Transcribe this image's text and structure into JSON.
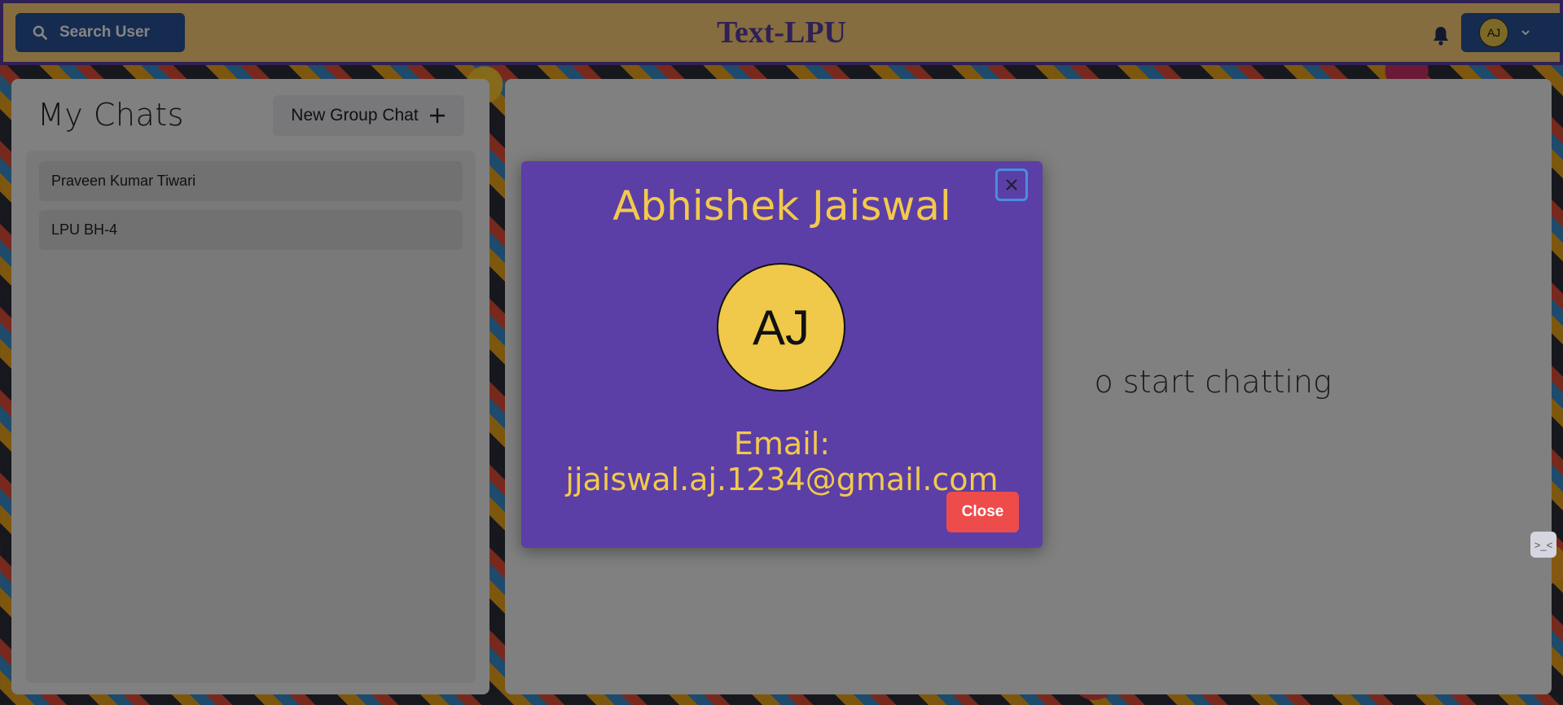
{
  "header": {
    "search_label": "Search User",
    "app_title": "Text-LPU",
    "profile_initials": "AJ"
  },
  "sidebar": {
    "title": "My Chats",
    "new_group_label": "New Group Chat",
    "chats": [
      {
        "name": "Praveen Kumar Tiwari"
      },
      {
        "name": "LPU BH-4"
      }
    ]
  },
  "main": {
    "placeholder_visible": "o start chatting"
  },
  "modal": {
    "name": "Abhishek Jaiswal",
    "initials": "AJ",
    "email_text": "Email: jjaiswal.aj.1234@gmail.com",
    "close_label": "Close"
  },
  "colors": {
    "header_bg": "#ffd27a",
    "accent_purple": "#5b3fa6",
    "button_blue": "#2a5499",
    "modal_text_gold": "#f3c94c",
    "close_red": "#ee4b4b"
  }
}
